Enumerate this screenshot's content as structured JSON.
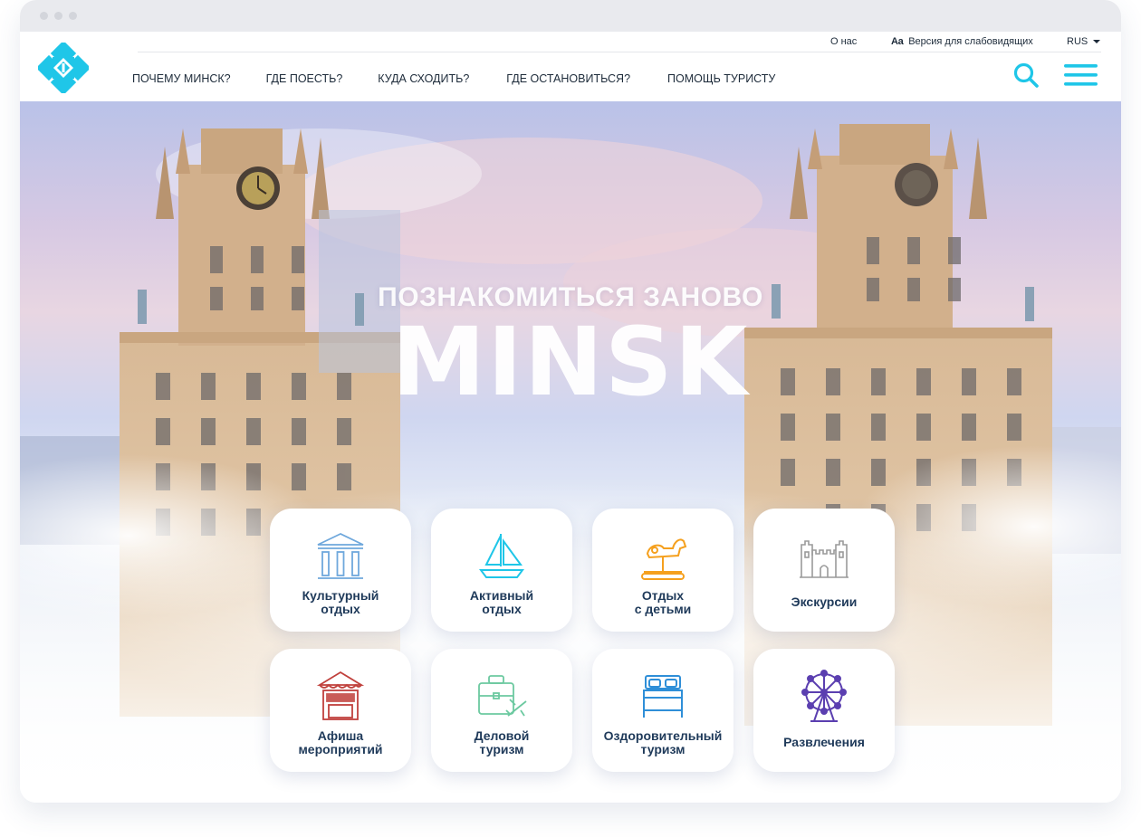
{
  "header": {
    "utility": {
      "about": "О нас",
      "aa": "Аа",
      "vision": "Версия для слабовидящих",
      "lang": "RUS"
    },
    "nav": [
      "ПОЧЕМУ МИНСК?",
      "ГДЕ ПОЕСТЬ?",
      "КУДА СХОДИТЬ?",
      "ГДЕ ОСТАНОВИТЬСЯ?",
      "ПОМОЩЬ ТУРИСТУ"
    ]
  },
  "hero": {
    "subtitle": "ПОЗНАКОМИТЬСЯ ЗАНОВО",
    "title": "MINSK"
  },
  "categories": [
    {
      "label": "Культурный\nотдых",
      "icon": "museum-icon",
      "color": "#6fa8dc"
    },
    {
      "label": "Активный\nотдых",
      "icon": "sailboat-icon",
      "color": "#1fc6e8"
    },
    {
      "label": "Отдых\nс детьми",
      "icon": "rocking-horse-icon",
      "color": "#f5a01e"
    },
    {
      "label": "Экскурсии",
      "icon": "castle-icon",
      "color": "#9a9a9a"
    },
    {
      "label": "Афиша\nмероприятий",
      "icon": "ticket-booth-icon",
      "color": "#c0403c"
    },
    {
      "label": "Деловой\nтуризм",
      "icon": "suitcase-plane-icon",
      "color": "#6cc9a0"
    },
    {
      "label": "Оздоровительный\nтуризм",
      "icon": "bed-icon",
      "color": "#2f8fd8"
    },
    {
      "label": "Развлечения",
      "icon": "ferris-wheel-icon",
      "color": "#5b3fb0"
    }
  ],
  "colors": {
    "accent": "#1fc6e8",
    "text": "#1d2b3a",
    "card_label": "#1f3a5a"
  }
}
